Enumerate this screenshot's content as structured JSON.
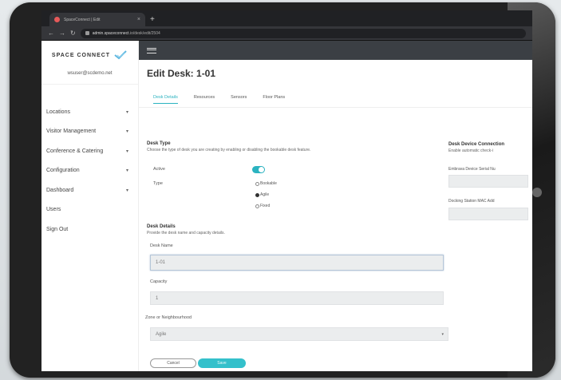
{
  "browser": {
    "tab_title": "SpaceConnect | Edit",
    "new_tab": "+",
    "url_host": "admin.spaceconnect",
    "url_rest": ".io/desk/edit/2504"
  },
  "sidebar": {
    "logo_text": "SPACE CONNECT",
    "user_email": "wsuser@scdemo.net",
    "items": [
      {
        "label": "Locations",
        "caret": "▾"
      },
      {
        "label": "Visitor Management",
        "caret": "▾"
      },
      {
        "label": "Conference & Catering",
        "caret": "▾"
      },
      {
        "label": "Configuration",
        "caret": "▾"
      },
      {
        "label": "Dashboard",
        "caret": "▾"
      },
      {
        "label": "Users",
        "caret": ""
      },
      {
        "label": "Sign Out",
        "caret": ""
      }
    ]
  },
  "page": {
    "title": "Edit Desk: 1-01",
    "tabs": [
      "Desk Details",
      "Resources",
      "Sensors",
      "Floor Plans"
    ]
  },
  "desk_type": {
    "title": "Desk Type",
    "desc": "Choose the type of desk you are creating by enabling or disabling the bookable desk feature.",
    "active_label": "Active",
    "type_label": "Type",
    "options": [
      "Bookable",
      "Agile",
      "Fixed"
    ],
    "selected": "Agile"
  },
  "desk_details": {
    "title": "Desk Details",
    "desc": "Provide the desk name and capacity details.",
    "name_label": "Desk Name",
    "name_value": "1-01",
    "capacity_label": "Capacity",
    "capacity_value": "1",
    "zone_label": "Zone or Neighbourhood",
    "zone_value": "Agile",
    "zone_caret": "▾"
  },
  "buttons": {
    "cancel": "Cancel",
    "save": "Save"
  },
  "device": {
    "title": "Desk Device Connection",
    "desc": "Enable automatic check-i",
    "entrance_label": "Embrava Device Serial Nu",
    "docking_label": "Docking Station MAC Add"
  },
  "colors": {
    "accent": "#2bb3c0",
    "topbar": "#3b3f44"
  }
}
